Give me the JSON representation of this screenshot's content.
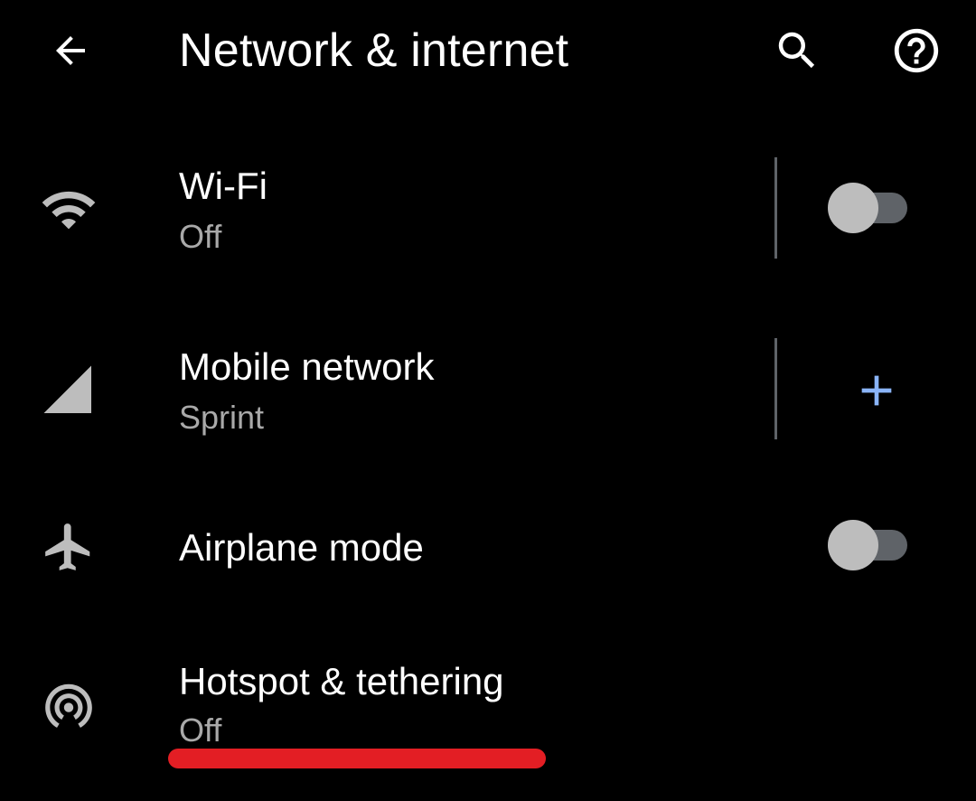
{
  "header": {
    "title": "Network & internet",
    "back_icon": "arrow-back-icon",
    "search_icon": "search-icon",
    "help_icon": "help-icon"
  },
  "settings": [
    {
      "id": "wifi",
      "title": "Wi-Fi",
      "summary": "Off",
      "icon": "wifi-icon",
      "control": "toggle",
      "toggle_on": false
    },
    {
      "id": "mobile",
      "title": "Mobile network",
      "summary": "Sprint",
      "icon": "signal-icon",
      "control": "add"
    },
    {
      "id": "airplane",
      "title": "Airplane mode",
      "icon": "airplane-icon",
      "control": "toggle",
      "toggle_on": false
    },
    {
      "id": "hotspot",
      "title": "Hotspot & tethering",
      "summary": "Off",
      "icon": "hotspot-icon"
    }
  ],
  "colors": {
    "background": "#000000",
    "text_primary": "#ffffff",
    "text_secondary": "#a9a9a9",
    "icon": "#bdbdbd",
    "accent": "#8ab4f8",
    "annotation": "#e31e24"
  }
}
